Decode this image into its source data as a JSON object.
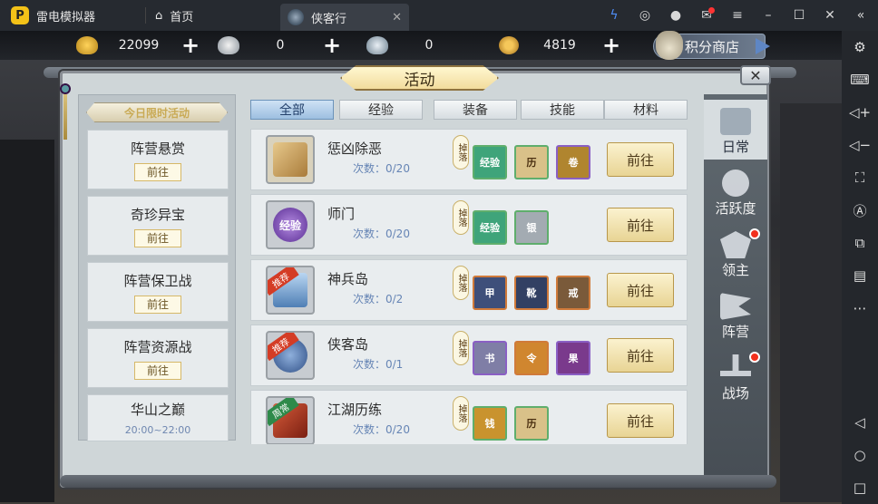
{
  "emulator": {
    "app_name": "雷电模拟器",
    "home_tab": "首页",
    "active_tab": "侠客行",
    "logo_text": "P"
  },
  "currency": {
    "gold": "22099",
    "silver": "0",
    "ingot": "0",
    "coin": "4819",
    "shop_label": "积分商店"
  },
  "panel": {
    "title": "活动",
    "close": "✕"
  },
  "limited": {
    "header": "今日限时活动",
    "items": [
      {
        "name": "阵营悬赏",
        "action": "前往"
      },
      {
        "name": "奇珍异宝",
        "action": "前往"
      },
      {
        "name": "阵营保卫战",
        "action": "前往"
      },
      {
        "name": "阵营资源战",
        "action": "前往"
      },
      {
        "name": "华山之巅",
        "time": "20:00~22:00"
      }
    ]
  },
  "categories": [
    "全部",
    "经验",
    "装备",
    "技能",
    "材料"
  ],
  "activities": [
    {
      "name": "惩凶除恶",
      "count": "次数：0/20",
      "drop": "掉落",
      "action": "前往",
      "badge": "",
      "rewards": [
        "经验",
        "历",
        "卷"
      ]
    },
    {
      "name": "师门",
      "count": "次数：0/20",
      "drop": "掉落",
      "action": "前往",
      "badge": "",
      "icon_text": "经验",
      "rewards": [
        "经验",
        "银"
      ]
    },
    {
      "name": "神兵岛",
      "count": "次数：0/2",
      "drop": "掉落",
      "action": "前往",
      "badge": "推荐",
      "rewards": [
        "甲",
        "靴",
        "戒"
      ]
    },
    {
      "name": "侠客岛",
      "count": "次数：0/1",
      "drop": "掉落",
      "action": "前往",
      "badge": "推荐",
      "rewards": [
        "书",
        "令",
        "果"
      ]
    },
    {
      "name": "江湖历练",
      "count": "次数：0/20",
      "drop": "掉落",
      "action": "前往",
      "badge": "周常",
      "rewards": [
        "钱",
        "历"
      ]
    }
  ],
  "side_tabs": [
    {
      "label": "日常",
      "active": true,
      "dot": false
    },
    {
      "label": "活跃度",
      "active": false,
      "dot": false
    },
    {
      "label": "领主",
      "active": false,
      "dot": true
    },
    {
      "label": "阵营",
      "active": false,
      "dot": false
    },
    {
      "label": "战场",
      "active": false,
      "dot": true
    }
  ],
  "colors": {
    "accent_blue": "#4f8ef7",
    "go_button": "#e8d494",
    "badge_red": "#d43c25",
    "count_text": "#6685b5"
  }
}
